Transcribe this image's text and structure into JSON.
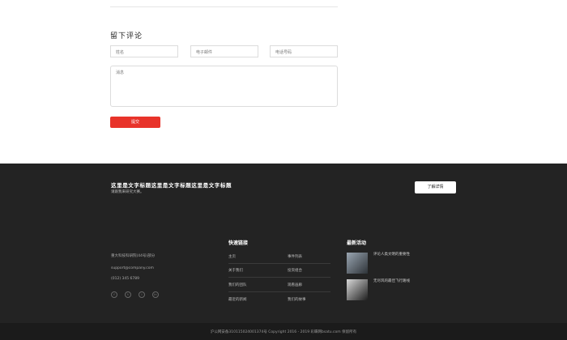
{
  "comment": {
    "title": "留下评论",
    "name_placeholder": "姓名",
    "email_placeholder": "电子邮件",
    "phone_placeholder": "电话号码",
    "message_placeholder": "消息",
    "submit_label": "提交"
  },
  "cta": {
    "title": "这里是文字标题这里是文字标题这里是文字标题",
    "subtitle": "请跟我来研究大赛。",
    "button_label": "了解详情"
  },
  "footer": {
    "address": "重大科技科研院(44号)部分",
    "email": "support@company.com",
    "phone": "(012) 345 6789",
    "quick_links_title": "快速链接",
    "quick_links": [
      "主页",
      "事件列表",
      "关于我们",
      "投资组合",
      "我们的团队",
      "观看画廊",
      "最近的新闻",
      "我们的故事"
    ],
    "recent_title": "最新活动",
    "recent_posts": [
      "评论人类文明的重要性",
      "无尽风的最佳飞行路线"
    ],
    "copyright": "沪公网安备310115024001374号 Copyright 2016 - 2019 彩蝶网bsatu.com 保留所有"
  },
  "icons": [
    "facebook-icon",
    "twitter-icon",
    "instagram-icon",
    "linkedin-icon"
  ],
  "colors": {
    "accent": "#e8332a",
    "footer_bg": "#232323",
    "bottom_bar_bg": "#1b1b1b"
  }
}
